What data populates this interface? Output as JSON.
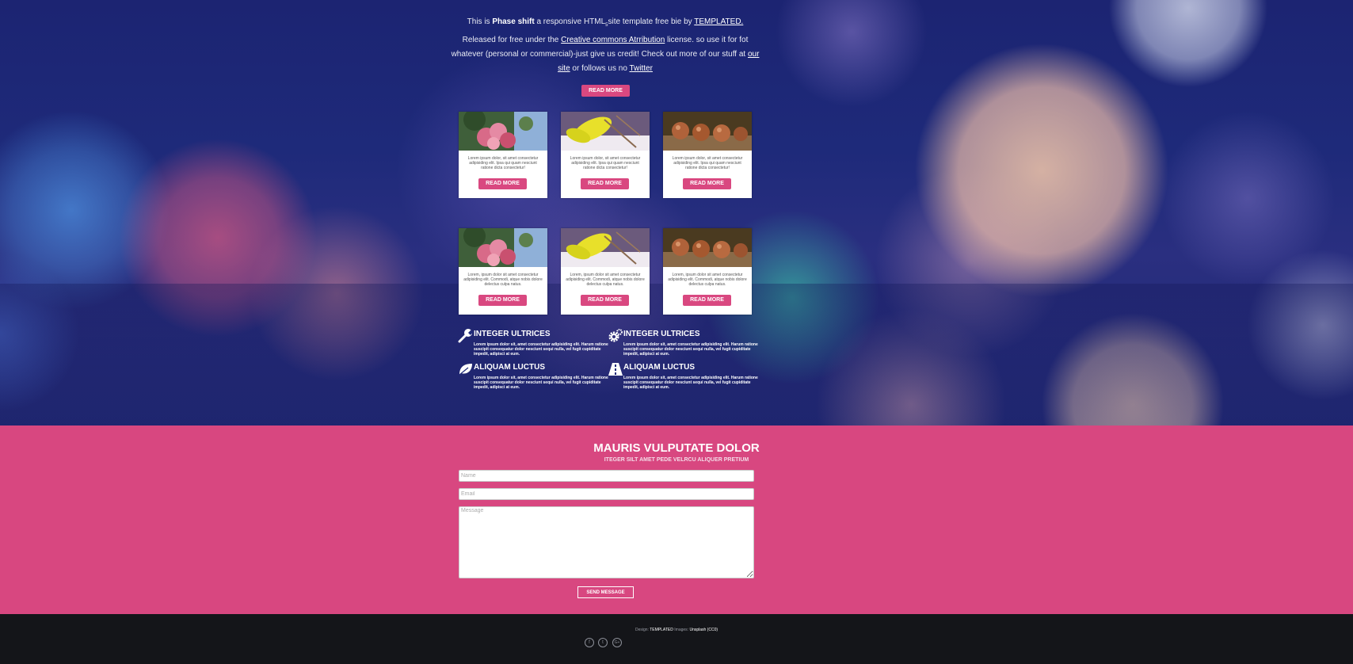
{
  "intro": {
    "line1_pre": "This is ",
    "line1_bold": "Phase shift",
    "line1_mid": " a responsive HTML",
    "line1_sub": "5",
    "line1_post": "site template free bie by ",
    "line1_link": "TEMPLATED.",
    "p2_pre": "Released for free under the ",
    "p2_link1": "Creative commons Atrribution",
    "p2_mid": " license. so use it for fot whatever (personal or commercial)-just give us credit! Check out more of our stuff at ",
    "p2_link2": "our site",
    "p2_mid2": " or follows us no ",
    "p2_link3": "Twitter",
    "button": "READ MORE"
  },
  "cards_row1": [
    {
      "image": "pink-blossom-photo",
      "text": "Lorem ipsum dolor, sit amet consectetur adipisiding elit. Ipsa qui quam nesciunt ratione dicta consectetur!",
      "button": "READ MORE"
    },
    {
      "image": "yellow-leaf-photo",
      "text": "Lorem ipsum dolor, sit amet consectetur adipisiding elit. Ipsa qui quam nesciunt ratione dicta consectetur!",
      "button": "READ MORE"
    },
    {
      "image": "seed-pods-photo",
      "text": "Lorem ipsum dolor, sit amet consectetur adipisiding elit. Ipsa qui quam nesciunt ratione dicta consectetur!",
      "button": "READ MORE"
    }
  ],
  "cards_row2": [
    {
      "image": "pink-blossom-photo",
      "text": "Lorem, ipsum dolor sit amet consectetur adipisiding elit. Commodi, atque nobis dolore delectus culpa natus.",
      "button": "READ MORE"
    },
    {
      "image": "yellow-leaf-photo",
      "text": "Lorem, ipsum dolor sit amet consectetur adipisiding elit. Commodi, atque nobis dolore delectus culpa natus.",
      "button": "READ MORE"
    },
    {
      "image": "seed-pods-photo",
      "text": "Lorem, ipsum dolor sit amet consectetur adipisiding elit. Commodi, atque nobis dolore delectus culpa natus.",
      "button": "READ MORE"
    }
  ],
  "features": [
    {
      "icon": "wrench-icon",
      "title": "INTEGER ULTRICES",
      "text": "Lorem ipsum dolor sit, amet consectetur adipisiding elit. Harum ratione suscipit consequatur dolor nesciunt sequi nulla, vel fugit cupiditate impedit, adipisci at eum."
    },
    {
      "icon": "gears-icon",
      "title": "INTEGER ULTRICES",
      "text": "Lorem ipsum dolor sit, amet consectetur adipisiding elit. Harum ratione suscipit consequatur dolor nesciunt sequi nulla, vel fugit cupiditate impedit, adipisci at eum."
    },
    {
      "icon": "leaf-icon",
      "title": "ALIQUAM LUCTUS",
      "text": "Lorem ipsum dolor sit, amet consectetur adipisiding elit. Harum ratione suscipit consequatur dolor nesciunt sequi nulla, vel fugit cupiditate impedit, adipisci at eum."
    },
    {
      "icon": "road-icon",
      "title": "ALIQUAM LUCTUS",
      "text": "Lorem ipsum dolor sit, amet consectetur adipisiding elit. Harum ratione suscipit consequatur dolor nesciunt sequi nulla, vel fugit cupiditate impedit, adipisci at eum."
    }
  ],
  "contact": {
    "title": "MAURIS VULPUTATE DOLOR",
    "subtitle": "ITEGER SILT AMET PEDE VELRCU ALIQUER PRETIUM",
    "name_placeholder": "Name",
    "email_placeholder": "Email",
    "message_placeholder": "Message",
    "send": "SEND MESSAGE"
  },
  "footer": {
    "design_label": "Design: ",
    "design_link": "TEMPLATED",
    "images_label": " Images: ",
    "images_link": "Unsplash (CC0)",
    "social": [
      {
        "icon": "facebook-icon",
        "glyph": "f"
      },
      {
        "icon": "twitter-icon",
        "glyph": "t"
      },
      {
        "icon": "googleplus-icon",
        "glyph": "G+"
      }
    ]
  },
  "colors": {
    "accent": "#d94880",
    "footer": "#141519",
    "hero": "#1e2a7a"
  }
}
